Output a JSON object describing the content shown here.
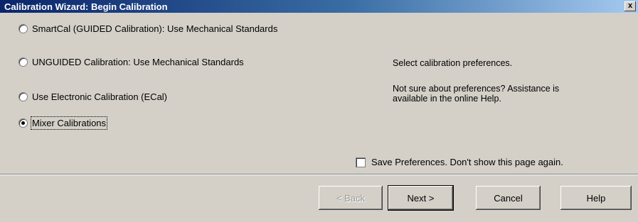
{
  "window": {
    "title": "Calibration Wizard: Begin Calibration",
    "close_label": "x"
  },
  "options": [
    {
      "label": "SmartCal (GUIDED Calibration): Use Mechanical Standards",
      "selected": false
    },
    {
      "label": "UNGUIDED Calibration: Use Mechanical Standards",
      "selected": false
    },
    {
      "label": "Use Electronic Calibration (ECal)",
      "selected": false
    },
    {
      "label": "Mixer Calibrations",
      "selected": true
    }
  ],
  "info": {
    "prompt": "Select calibration preferences.",
    "help_line1": "Not sure about preferences?  Assistance is",
    "help_line2": "available in the online Help."
  },
  "save_preferences": {
    "label": "Save Preferences.  Don't show this page again.",
    "checked": false
  },
  "buttons": {
    "back": "< Back",
    "next": "Next >",
    "cancel": "Cancel",
    "help": "Help"
  }
}
